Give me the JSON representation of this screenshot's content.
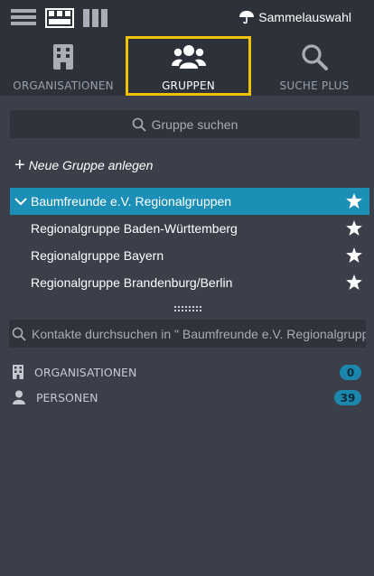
{
  "header": {
    "sammelauswahl_label": "Sammelauswahl"
  },
  "nav_tabs": [
    {
      "label": "ORGANISATIONEN",
      "icon": "building-icon",
      "active": false
    },
    {
      "label": "GRUPPEN",
      "icon": "users-group-icon",
      "active": true
    },
    {
      "label": "SUCHE PLUS",
      "icon": "search-icon",
      "active": false
    }
  ],
  "group_search": {
    "placeholder": "Gruppe suchen"
  },
  "new_group": {
    "label": "Neue Gruppe anlegen"
  },
  "tree": {
    "parent": {
      "label": "Baumfreunde e.V. Regionalgruppen",
      "expanded": true,
      "selected": true
    },
    "children": [
      {
        "label": "Regionalgruppe Baden-Württemberg"
      },
      {
        "label": "Regionalgruppe Bayern"
      },
      {
        "label": "Regionalgruppe Brandenburg/Berlin"
      }
    ]
  },
  "contact_search": {
    "placeholder": "Kontakte durchsuchen in \" Baumfreunde e.V. Regionalgrupp..."
  },
  "counts": [
    {
      "label": "ORGANISATIONEN",
      "value": "0",
      "icon": "building-icon"
    },
    {
      "label": "PERSONEN",
      "value": "39",
      "icon": "person-icon"
    }
  ],
  "colors": {
    "background": "#3b3f4a",
    "header": "#2d313a",
    "accent": "#1b8fb5",
    "active_tab_border": "#f2c200"
  }
}
